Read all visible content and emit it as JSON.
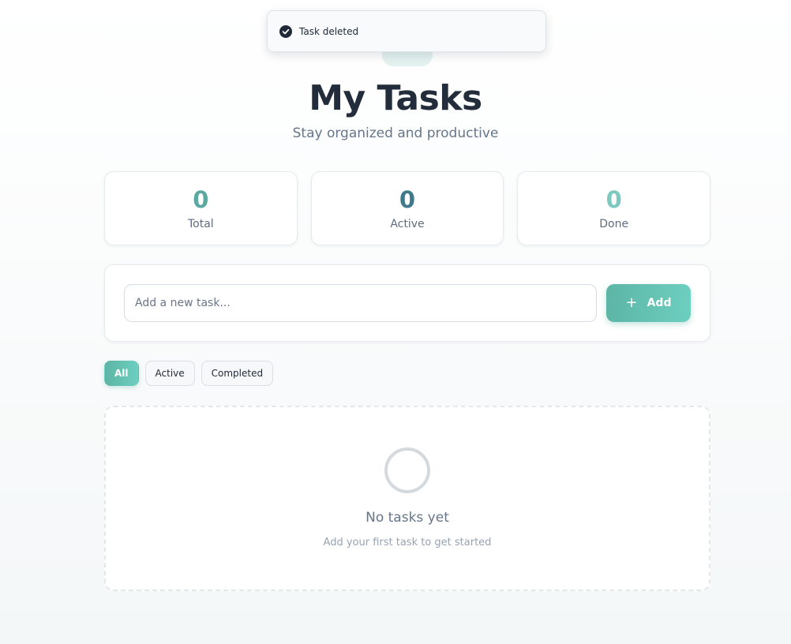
{
  "toast": {
    "message": "Task deleted",
    "icon": "check-circle-icon"
  },
  "header": {
    "title": "My Tasks",
    "subtitle": "Stay organized and productive"
  },
  "stats": [
    {
      "value": "0",
      "label": "Total",
      "color": "#5aa9a0"
    },
    {
      "value": "0",
      "label": "Active",
      "color": "#3f7a8c"
    },
    {
      "value": "0",
      "label": "Done",
      "color": "#7cc9bf"
    }
  ],
  "add_task": {
    "input_value": "",
    "placeholder": "Add a new task...",
    "button_label": "Add",
    "button_icon": "plus-icon"
  },
  "filters": [
    {
      "label": "All",
      "active": true
    },
    {
      "label": "Active",
      "active": false
    },
    {
      "label": "Completed",
      "active": false
    }
  ],
  "empty_state": {
    "icon": "empty-circle-icon",
    "title": "No tasks yet",
    "subtitle": "Add your first task to get started"
  },
  "colors": {
    "accent_start": "#5db5a5",
    "accent_end": "#6ccfc0",
    "title": "#222c3a",
    "muted": "#66768a"
  }
}
